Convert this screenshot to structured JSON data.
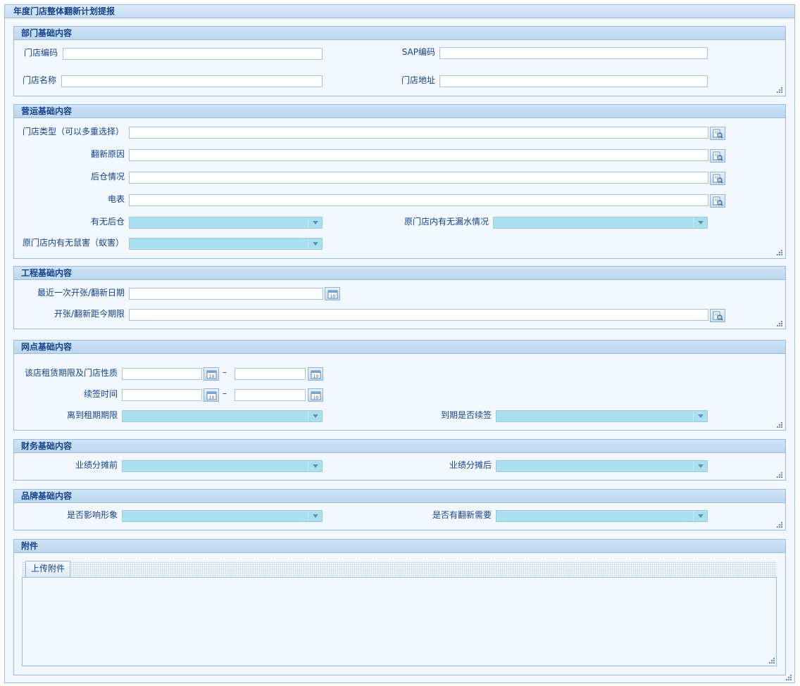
{
  "title": "年度门店整体翻新计划提报",
  "sections": {
    "dept": {
      "title": "部门基础内容",
      "store_code": "门店编码",
      "sap_code": "SAP编码",
      "store_name": "门店名称",
      "store_address": "门店地址"
    },
    "ops": {
      "title": "营运基础内容",
      "store_type": "门店类型（可以多重选择）",
      "renovation_reason": "翻新原因",
      "warehouse_status": "后仓情况",
      "meter": "电表",
      "has_warehouse": "有无后仓",
      "leak_status": "原门店内有无漏水情况",
      "pest_status": "原门店内有无鼠害（蚁害）"
    },
    "eng": {
      "title": "工程基础内容",
      "last_date": "最近一次开张/翻新日期",
      "period": "开张/翻新距今期限"
    },
    "site": {
      "title": "网点基础内容",
      "lease_period": "该店租赁期限及门店性质",
      "renewal_time": "续签时间",
      "lease_remaining": "离到租期期限",
      "renew_on_expiry": "到期是否续签",
      "range_sep": "–"
    },
    "finance": {
      "title": "财务基础内容",
      "before": "业绩分摊前",
      "after": "业绩分摊后"
    },
    "brand": {
      "title": "品牌基础内容",
      "affects_image": "是否影响形象",
      "needs_renovation": "是否有翻新需要"
    },
    "attach": {
      "title": "附件",
      "tab_upload": "上传附件"
    }
  },
  "icons": [
    "search-icon",
    "calendar-icon",
    "dropdown-arrow-icon",
    "resize-grip-icon"
  ],
  "colors": {
    "border": "#99bbe8",
    "text": "#15428b",
    "combo_bg": "#a9e0ef",
    "panel_bg": "#f2f8fd"
  }
}
